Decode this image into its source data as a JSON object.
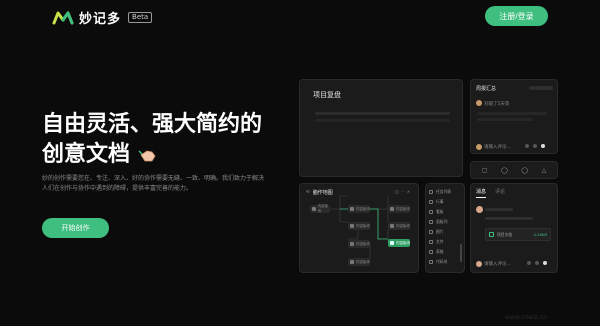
{
  "header": {
    "logo_text": "妙记多",
    "beta_label": "Beta",
    "login_label": "注册/登录"
  },
  "hero": {
    "title_line1": "自由灵活、强大简约的",
    "title_line2": "创意文档",
    "description": "妙的创作需要您在、专注、深入、好的协作需要无缝、一致、明确。我们致力于解决人们在创作与协作中遇到的障碍，提供丰富完善的能力。",
    "cta_label": "开始创作"
  },
  "cards": {
    "project_review": {
      "title": "项目复盘"
    },
    "weekly_summary": {
      "title": "周报汇总",
      "author_label": "刘丽了5天等",
      "input_placeholder": "请输入评论..."
    },
    "mind_map": {
      "title": "脑作地图",
      "node_label": "内容板块"
    },
    "side_menu": {
      "items": [
        "任务列表",
        "行事",
        "看板",
        "面板列",
        "图片",
        "文件",
        "表格",
        "代码块"
      ]
    },
    "messages": {
      "tabs": [
        "消息",
        "评论"
      ],
      "attachment_name": "项目文档",
      "attachment_size": "4.28KB",
      "input_placeholder": "请输入评论..."
    }
  },
  "toolbar_strip": {
    "icons": [
      "chat-icon",
      "clock-icon",
      "user-icon",
      "bell-icon"
    ]
  },
  "watermark": "www.cnwiz.cn",
  "colors": {
    "accent": "#3fbf7f",
    "background": "#0b0b0b",
    "card": "#1b1b1b"
  }
}
